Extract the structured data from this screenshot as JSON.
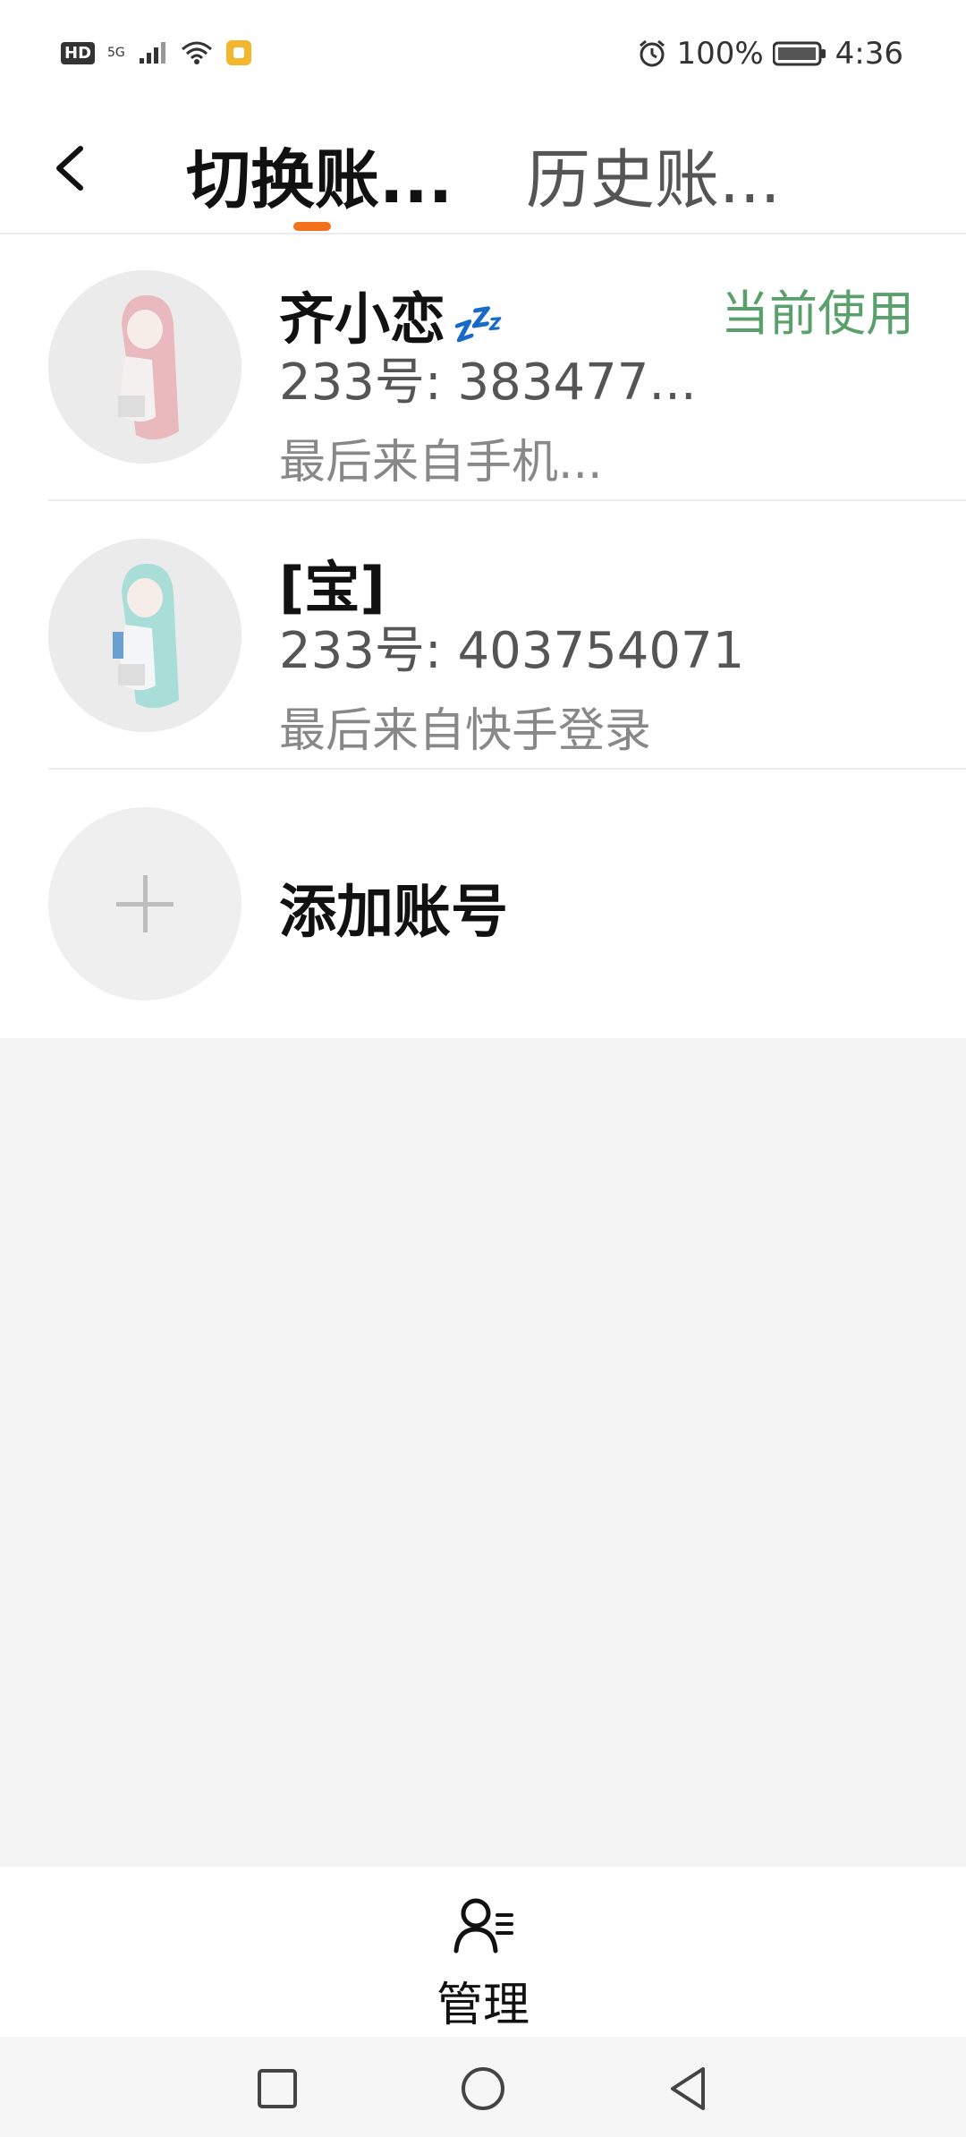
{
  "status": {
    "hd": "HD",
    "network": "5G",
    "battery": "100%",
    "time": "4:36",
    "icons": [
      "hd-icon",
      "signal-icon",
      "wifi-icon",
      "notification-icon",
      "alarm-icon",
      "battery-icon"
    ]
  },
  "tabs": {
    "active": "切换账...",
    "inactive": "历史账...",
    "accent": "#f3711c"
  },
  "accounts": [
    {
      "name": "齐小恋",
      "badge": "💤",
      "uid": "233号: 383477...",
      "last": "最后来自手机...",
      "status": "当前使用",
      "status_color": "#5aa06a"
    },
    {
      "name": "[宝]",
      "uid": "233号: 403754071",
      "last": "最后来自快手登录"
    }
  ],
  "add": {
    "label": "添加账号"
  },
  "bottom": {
    "manage_label": "管理"
  },
  "nav": {
    "buttons": [
      "square-icon",
      "circle-icon",
      "back-triangle-icon"
    ]
  }
}
